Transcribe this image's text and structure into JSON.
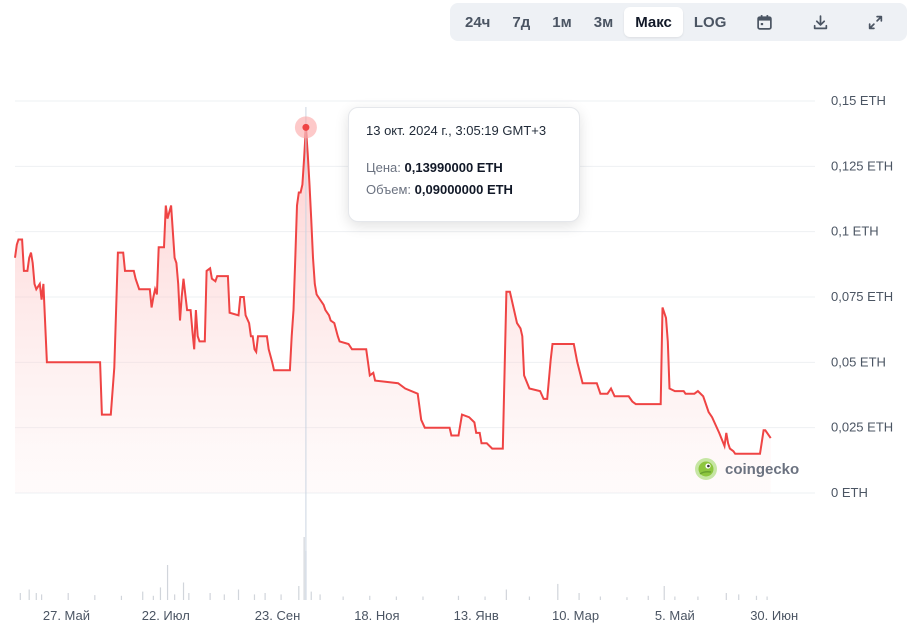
{
  "toolbar": {
    "range_buttons": [
      "24ч",
      "7д",
      "1м",
      "3м",
      "Макс"
    ],
    "active_range": "Макс",
    "log_label": "LOG",
    "icons": [
      "calendar-icon",
      "download-icon",
      "expand-icon"
    ]
  },
  "tooltip": {
    "date": "13 окт. 2024 г., 3:05:19 GMT+3",
    "price_label": "Цена:",
    "price_value": "0,13990000 ETH",
    "volume_label": "Объем:",
    "volume_value": "0,09000000 ETH"
  },
  "watermark": "coingecko",
  "colors": {
    "line": "#ef4444",
    "area_fill": "#fde2e2",
    "crosshair": "#cbd5e1",
    "grid": "#eef0f3",
    "volume": "#d1d5db"
  },
  "chart_data": {
    "type": "area",
    "y_unit": "ETH",
    "y_ticks": [
      "0 ETH",
      "0,025 ETH",
      "0,05 ETH",
      "0,075 ETH",
      "0,1 ETH",
      "0,125 ETH",
      "0,15 ETH"
    ],
    "y_tick_values": [
      0,
      0.025,
      0.05,
      0.075,
      0.1,
      0.125,
      0.15
    ],
    "ylim": [
      0,
      0.15
    ],
    "x_ticks": [
      "27. Май",
      "22. Июл",
      "23. Сен",
      "18. Ноя",
      "13. Янв",
      "10. Мар",
      "5. Май",
      "30. Июн"
    ],
    "x_tick_days": [
      29,
      85,
      148,
      204,
      260,
      316,
      372,
      428
    ],
    "x_range_days": [
      0,
      451
    ],
    "x_start_date": "2024-04-28",
    "series": [
      {
        "points": [
          [
            0,
            0.09
          ],
          [
            1,
            0.095
          ],
          [
            2,
            0.097
          ],
          [
            4,
            0.097
          ],
          [
            5,
            0.085
          ],
          [
            7,
            0.085
          ],
          [
            8,
            0.09
          ],
          [
            9,
            0.092
          ],
          [
            10,
            0.088
          ],
          [
            11,
            0.08
          ],
          [
            12,
            0.078
          ],
          [
            14,
            0.08
          ],
          [
            15,
            0.074
          ],
          [
            16,
            0.08
          ],
          [
            18,
            0.05
          ],
          [
            40,
            0.05
          ],
          [
            48,
            0.05
          ],
          [
            49,
            0.03
          ],
          [
            54,
            0.03
          ],
          [
            56,
            0.048
          ],
          [
            58,
            0.092
          ],
          [
            61,
            0.092
          ],
          [
            62,
            0.085
          ],
          [
            67,
            0.085
          ],
          [
            68,
            0.082
          ],
          [
            70,
            0.078
          ],
          [
            76,
            0.078
          ],
          [
            77,
            0.071
          ],
          [
            78,
            0.075
          ],
          [
            79,
            0.078
          ],
          [
            80,
            0.076
          ],
          [
            81,
            0.094
          ],
          [
            84,
            0.094
          ],
          [
            85,
            0.11
          ],
          [
            86,
            0.105
          ],
          [
            88,
            0.11
          ],
          [
            90,
            0.09
          ],
          [
            91,
            0.088
          ],
          [
            92,
            0.08
          ],
          [
            93,
            0.066
          ],
          [
            94,
            0.075
          ],
          [
            95,
            0.082
          ],
          [
            97,
            0.07
          ],
          [
            99,
            0.07
          ],
          [
            100,
            0.062
          ],
          [
            101,
            0.055
          ],
          [
            102,
            0.07
          ],
          [
            103,
            0.06
          ],
          [
            104,
            0.058
          ],
          [
            107,
            0.058
          ],
          [
            108,
            0.085
          ],
          [
            110,
            0.086
          ],
          [
            111,
            0.082
          ],
          [
            113,
            0.081
          ],
          [
            114,
            0.083
          ],
          [
            120,
            0.083
          ],
          [
            121,
            0.069
          ],
          [
            126,
            0.068
          ],
          [
            127,
            0.075
          ],
          [
            129,
            0.075
          ],
          [
            130,
            0.068
          ],
          [
            132,
            0.065
          ],
          [
            133,
            0.06
          ],
          [
            134,
            0.06
          ],
          [
            135,
            0.055
          ],
          [
            136,
            0.054
          ],
          [
            137,
            0.06
          ],
          [
            142,
            0.06
          ],
          [
            143,
            0.055
          ],
          [
            145,
            0.05
          ],
          [
            146,
            0.047
          ],
          [
            155,
            0.047
          ],
          [
            156,
            0.06
          ],
          [
            157,
            0.07
          ],
          [
            158,
            0.09
          ],
          [
            159,
            0.11
          ],
          [
            160,
            0.115
          ],
          [
            161,
            0.115
          ],
          [
            162,
            0.118
          ],
          [
            163,
            0.128
          ],
          [
            164,
            0.1399
          ],
          [
            165,
            0.13
          ],
          [
            166,
            0.118
          ],
          [
            167,
            0.105
          ],
          [
            168,
            0.09
          ],
          [
            169,
            0.08
          ],
          [
            170,
            0.076
          ],
          [
            171,
            0.075
          ],
          [
            174,
            0.072
          ],
          [
            175,
            0.07
          ],
          [
            177,
            0.068
          ],
          [
            178,
            0.066
          ],
          [
            180,
            0.065
          ],
          [
            182,
            0.06
          ],
          [
            183,
            0.058
          ],
          [
            188,
            0.057
          ],
          [
            190,
            0.055
          ],
          [
            198,
            0.055
          ],
          [
            199,
            0.05
          ],
          [
            200,
            0.045
          ],
          [
            202,
            0.046
          ],
          [
            203,
            0.043
          ],
          [
            216,
            0.042
          ],
          [
            220,
            0.04
          ],
          [
            227,
            0.038
          ],
          [
            229,
            0.028
          ],
          [
            231,
            0.025
          ],
          [
            245,
            0.025
          ],
          [
            246,
            0.022
          ],
          [
            250,
            0.022
          ],
          [
            252,
            0.03
          ],
          [
            256,
            0.029
          ],
          [
            259,
            0.027
          ],
          [
            260,
            0.023
          ],
          [
            262,
            0.023
          ],
          [
            263,
            0.019
          ],
          [
            266,
            0.019
          ],
          [
            269,
            0.017
          ],
          [
            275,
            0.017
          ],
          [
            277,
            0.077
          ],
          [
            279,
            0.077
          ],
          [
            283,
            0.065
          ],
          [
            285,
            0.063
          ],
          [
            286,
            0.06
          ],
          [
            287,
            0.045
          ],
          [
            290,
            0.04
          ],
          [
            296,
            0.039
          ],
          [
            298,
            0.036
          ],
          [
            300,
            0.036
          ],
          [
            302,
            0.051
          ],
          [
            303,
            0.057
          ],
          [
            315,
            0.057
          ],
          [
            317,
            0.05
          ],
          [
            320,
            0.042
          ],
          [
            328,
            0.042
          ],
          [
            330,
            0.038
          ],
          [
            334,
            0.038
          ],
          [
            336,
            0.04
          ],
          [
            338,
            0.037
          ],
          [
            346,
            0.037
          ],
          [
            348,
            0.035
          ],
          [
            350,
            0.034
          ],
          [
            360,
            0.034
          ],
          [
            364,
            0.034
          ],
          [
            365,
            0.071
          ],
          [
            367,
            0.067
          ],
          [
            368,
            0.058
          ],
          [
            369,
            0.04
          ],
          [
            372,
            0.039
          ],
          [
            377,
            0.039
          ],
          [
            378,
            0.038
          ],
          [
            383,
            0.038
          ],
          [
            385,
            0.039
          ],
          [
            388,
            0.037
          ],
          [
            391,
            0.031
          ],
          [
            393,
            0.029
          ],
          [
            397,
            0.023
          ],
          [
            400,
            0.018
          ],
          [
            401,
            0.023
          ],
          [
            402,
            0.019
          ],
          [
            403,
            0.017
          ],
          [
            405,
            0.016
          ],
          [
            406,
            0.015
          ],
          [
            412,
            0.015
          ],
          [
            413,
            0.015
          ],
          [
            420,
            0.015
          ],
          [
            422,
            0.024
          ],
          [
            423,
            0.024
          ],
          [
            426,
            0.021
          ]
        ]
      }
    ],
    "highlight": {
      "day": 164,
      "value": 0.1399
    },
    "volume": {
      "note": "relative bar heights at bottom of chart",
      "values": [
        [
          3,
          0.1
        ],
        [
          8,
          0.15
        ],
        [
          12,
          0.1
        ],
        [
          15,
          0.08
        ],
        [
          30,
          0.1
        ],
        [
          45,
          0.07
        ],
        [
          60,
          0.06
        ],
        [
          72,
          0.12
        ],
        [
          78,
          0.06
        ],
        [
          82,
          0.18
        ],
        [
          86,
          0.5
        ],
        [
          90,
          0.08
        ],
        [
          95,
          0.25
        ],
        [
          98,
          0.1
        ],
        [
          110,
          0.1
        ],
        [
          118,
          0.08
        ],
        [
          126,
          0.15
        ],
        [
          135,
          0.08
        ],
        [
          141,
          0.1
        ],
        [
          150,
          0.08
        ],
        [
          160,
          0.2
        ],
        [
          163,
          0.9
        ],
        [
          164,
          0.7
        ],
        [
          167,
          0.12
        ],
        [
          172,
          0.08
        ],
        [
          185,
          0.05
        ],
        [
          200,
          0.06
        ],
        [
          215,
          0.05
        ],
        [
          230,
          0.05
        ],
        [
          250,
          0.06
        ],
        [
          265,
          0.05
        ],
        [
          277,
          0.15
        ],
        [
          290,
          0.05
        ],
        [
          306,
          0.23
        ],
        [
          318,
          0.1
        ],
        [
          330,
          0.05
        ],
        [
          345,
          0.04
        ],
        [
          357,
          0.06
        ],
        [
          366,
          0.2
        ],
        [
          372,
          0.05
        ],
        [
          385,
          0.05
        ],
        [
          401,
          0.1
        ],
        [
          408,
          0.08
        ],
        [
          418,
          0.06
        ],
        [
          424,
          0.05
        ]
      ]
    }
  }
}
